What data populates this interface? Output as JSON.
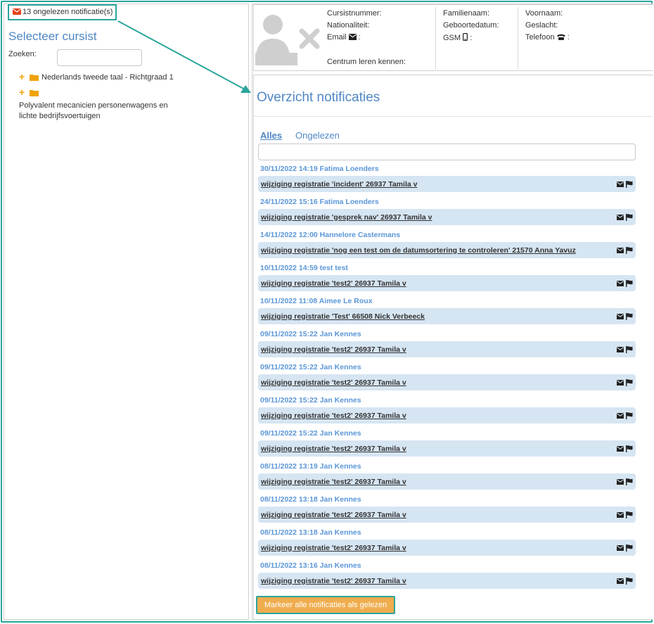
{
  "colors": {
    "accent_teal": "#2aa59b",
    "title_blue": "#4f87c5",
    "link_blue": "#5a96d8",
    "row_bg": "#d6e5f2",
    "button_orange": "#f0ad4e",
    "notif_icon_red": "#e8401a",
    "tree_orange": "#f0a30a"
  },
  "left": {
    "notif_badge": "13 ongelezen notificatie(s)",
    "select_title": "Selecteer cursist",
    "search_label": "Zoeken:",
    "search_value": "",
    "tree": [
      {
        "label": "Nederlands tweede taal - Richtgraad 1",
        "icon": "folder-icon"
      },
      {
        "label": "Polyvalent mecanicien personenwagens en lichte bedrijfsvoertuigen",
        "icon": "folder-icon"
      }
    ]
  },
  "profile": {
    "cursistnummer": "Cursistnummer:",
    "nationaliteit": "Nationaliteit:",
    "email": "Email",
    "email_suffix": ":",
    "centrum": "Centrum leren kennen:",
    "familienaam": "Familienaam:",
    "geboortedatum": "Geboortedatum:",
    "gsm": "GSM",
    "gsm_suffix": ":",
    "voornaam": "Voornaam:",
    "geslacht": "Geslacht:",
    "telefoon": "Telefoon",
    "telefoon_suffix": ":"
  },
  "main": {
    "title": "Overzicht notificaties",
    "tabs": [
      {
        "label": "Alles",
        "active": true
      },
      {
        "label": "Ongelezen",
        "active": false
      }
    ],
    "filter_value": "",
    "notifications": [
      {
        "header": "30/11/2022 14:19 Fatima Loenders",
        "subject": "wijziging registratie 'incident' 26937 Tamila v"
      },
      {
        "header": "24/11/2022 15:16 Fatima Loenders",
        "subject": "wijziging registratie 'gesprek nav' 26937 Tamila v"
      },
      {
        "header": "14/11/2022 12:00 Hannelore Castermans",
        "subject": "wijziging registratie 'nog een test om de datumsortering te controleren' 21570 Anna Yavuz"
      },
      {
        "header": "10/11/2022 14:59 test test",
        "subject": "wijziging registratie 'test2' 26937 Tamila v"
      },
      {
        "header": "10/11/2022 11:08 Aimee Le Roux",
        "subject": "wijziging registratie 'Test' 66508 Nick Verbeeck"
      },
      {
        "header": "09/11/2022 15:22 Jan Kennes",
        "subject": "wijziging registratie 'test2' 26937 Tamila v"
      },
      {
        "header": "09/11/2022 15:22 Jan Kennes",
        "subject": "wijziging registratie 'test2' 26937 Tamila v"
      },
      {
        "header": "09/11/2022 15:22 Jan Kennes",
        "subject": "wijziging registratie 'test2' 26937 Tamila v"
      },
      {
        "header": "09/11/2022 15:22 Jan Kennes",
        "subject": "wijziging registratie 'test2' 26937 Tamila v"
      },
      {
        "header": "08/11/2022 13:19 Jan Kennes",
        "subject": "wijziging registratie 'test2' 26937 Tamila v"
      },
      {
        "header": "08/11/2022 13:18 Jan Kennes",
        "subject": "wijziging registratie 'test2' 26937 Tamila v"
      },
      {
        "header": "08/11/2022 13:18 Jan Kennes",
        "subject": "wijziging registratie 'test2' 26937 Tamila v"
      },
      {
        "header": "08/11/2022 13:16 Jan Kennes",
        "subject": "wijziging registratie 'test2' 26937 Tamila v"
      }
    ],
    "mark_all_label": "Markeer alle notificaties als gelezen"
  }
}
